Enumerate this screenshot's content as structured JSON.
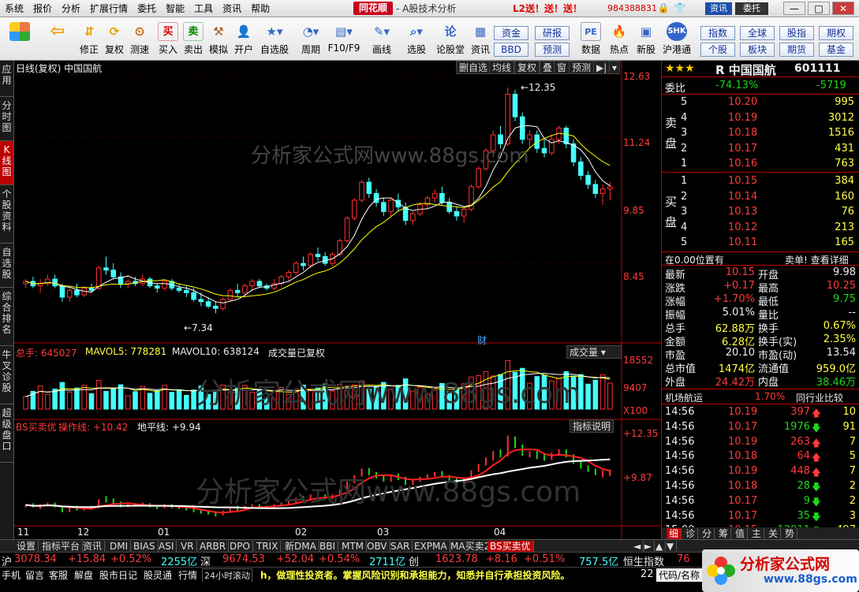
{
  "menu": [
    "系统",
    "报价",
    "分析",
    "扩展行情",
    "委托",
    "智能",
    "工具",
    "资讯",
    "帮助"
  ],
  "brand": "同花顺",
  "app_title": "- A股技术分析",
  "promo": "L2送！送！送！",
  "account": "984388831",
  "mini_buttons": {
    "news": "资讯",
    "trade": "委托"
  },
  "toolbar": [
    {
      "label": "",
      "icon": "windows-logo-icon"
    },
    {
      "label": "",
      "icon": "back-arrow-icon"
    },
    {
      "label": "修正",
      "icon": "up-down-arrow-icon"
    },
    {
      "label": "复权",
      "icon": "refresh-icon"
    },
    {
      "label": "测速",
      "icon": "clock-icon"
    },
    {
      "label": "买入",
      "icon": "buy-icon",
      "glyph": "买"
    },
    {
      "label": "卖出",
      "icon": "sell-icon",
      "glyph": "卖"
    },
    {
      "label": "模拟",
      "icon": "gavel-icon"
    },
    {
      "label": "开户",
      "icon": "person-icon"
    },
    {
      "label": "自选股",
      "icon": "star-list-icon"
    },
    {
      "label": "周期",
      "icon": "period-icon"
    },
    {
      "label": "F10/F9",
      "icon": "f10-icon"
    },
    {
      "label": "画线",
      "icon": "pencil-icon"
    },
    {
      "label": "选股",
      "icon": "stock-picker-icon"
    },
    {
      "label": "论股堂",
      "icon": "forum-icon"
    },
    {
      "label": "资讯",
      "icon": "news-icon"
    },
    {
      "label": "数据",
      "icon": "pe-icon",
      "glyph": "PE"
    },
    {
      "label": "热点",
      "icon": "hot-icon"
    },
    {
      "label": "新股",
      "icon": "new-stock-icon"
    },
    {
      "label": "沪港通",
      "icon": "shhk-icon"
    }
  ],
  "toolbar_right": [
    "资金",
    "研报",
    "BBD",
    "预测",
    "指数",
    "全球",
    "股指",
    "期权",
    "个股",
    "板块",
    "期货",
    "基金"
  ],
  "sidebar_tabs": [
    "应用",
    "分时图",
    "K线图",
    "个股资料",
    "自选股",
    "综合排名",
    "牛叉诊股",
    "超级盘口"
  ],
  "chart": {
    "header_left": "日线(复权) 中国国航",
    "header_buttons": [
      "删自选",
      "均线",
      "复权",
      "叠",
      "窗",
      "预测"
    ],
    "price_labels": [
      "12.63",
      "11.24",
      "9.85",
      "8.45"
    ],
    "max_label": "12.35",
    "min_label": "7.34",
    "watermark": "分析家公式网www.88gs.com",
    "fin_marker": "财",
    "vol_header": {
      "zongshou": "总手: 645027",
      "mavol5": "MAVOL5: 778281",
      "mavol10": "MAVOL10: 638124",
      "note": "成交量已复权",
      "selector": "成交量"
    },
    "vol_labels": [
      "18552",
      "9407",
      "X100"
    ],
    "bs_header": {
      "name": "BS买卖优",
      "op": "操作线: +10.42",
      "ground": "地平线: +9.94"
    },
    "bs_button": "指标说明",
    "bs_labels": [
      "+12.35",
      "+9.87"
    ],
    "x_labels": [
      "11",
      "12",
      "01",
      "02",
      "03",
      "04"
    ]
  },
  "chart_data": {
    "type": "candlestick",
    "title": "中国国航 日线(复权)",
    "ylim": [
      7.0,
      12.63
    ],
    "candles": [
      [
        8.0,
        8.1,
        7.9,
        8.05
      ],
      [
        8.05,
        8.15,
        7.9,
        7.95
      ],
      [
        7.95,
        8.1,
        7.8,
        8.0
      ],
      [
        8.0,
        8.2,
        7.95,
        8.1
      ],
      [
        8.1,
        8.2,
        7.9,
        7.95
      ],
      [
        7.95,
        8.0,
        7.6,
        7.7
      ],
      [
        7.7,
        7.9,
        7.6,
        7.85
      ],
      [
        7.85,
        8.0,
        7.7,
        7.75
      ],
      [
        7.75,
        7.95,
        7.7,
        7.9
      ],
      [
        7.9,
        8.0,
        7.8,
        7.85
      ],
      [
        7.9,
        8.4,
        7.85,
        8.35
      ],
      [
        8.35,
        8.6,
        8.2,
        8.3
      ],
      [
        8.3,
        8.45,
        8.1,
        8.15
      ],
      [
        8.15,
        8.25,
        7.9,
        8.0
      ],
      [
        8.0,
        8.1,
        7.9,
        8.05
      ],
      [
        8.05,
        8.15,
        7.95,
        8.0
      ],
      [
        8.0,
        8.2,
        7.95,
        8.1
      ],
      [
        8.1,
        8.15,
        7.9,
        7.95
      ],
      [
        7.95,
        8.0,
        7.8,
        7.9
      ],
      [
        7.9,
        8.1,
        7.85,
        8.05
      ],
      [
        8.05,
        8.1,
        7.85,
        7.9
      ],
      [
        7.9,
        8.0,
        7.8,
        7.85
      ],
      [
        7.85,
        7.95,
        7.7,
        7.8
      ],
      [
        7.8,
        7.9,
        7.6,
        7.65
      ],
      [
        7.65,
        7.8,
        7.5,
        7.6
      ],
      [
        7.6,
        7.7,
        7.45,
        7.5
      ],
      [
        7.5,
        7.6,
        7.34,
        7.45
      ],
      [
        7.45,
        7.7,
        7.4,
        7.65
      ],
      [
        7.65,
        7.9,
        7.6,
        7.85
      ],
      [
        7.85,
        8.0,
        7.7,
        7.8
      ],
      [
        7.8,
        8.0,
        7.75,
        7.95
      ],
      [
        7.95,
        8.1,
        7.85,
        8.05
      ],
      [
        8.05,
        8.1,
        7.9,
        7.95
      ],
      [
        7.95,
        8.0,
        7.85,
        7.9
      ],
      [
        7.9,
        8.1,
        7.85,
        8.0
      ],
      [
        8.0,
        8.2,
        7.95,
        8.15
      ],
      [
        8.15,
        8.3,
        8.05,
        8.25
      ],
      [
        8.25,
        8.5,
        8.2,
        8.45
      ],
      [
        8.45,
        8.6,
        8.3,
        8.4
      ],
      [
        8.4,
        8.7,
        8.35,
        8.65
      ],
      [
        8.65,
        8.8,
        8.5,
        8.6
      ],
      [
        8.6,
        8.7,
        8.4,
        8.45
      ],
      [
        8.45,
        8.7,
        8.4,
        8.65
      ],
      [
        8.65,
        9.0,
        8.6,
        8.95
      ],
      [
        8.95,
        9.5,
        8.9,
        9.45
      ],
      [
        9.45,
        9.9,
        9.4,
        9.85
      ],
      [
        9.85,
        10.3,
        9.8,
        10.25
      ],
      [
        10.25,
        10.35,
        9.9,
        10.0
      ],
      [
        10.0,
        10.1,
        9.7,
        9.8
      ],
      [
        9.8,
        9.9,
        9.5,
        9.6
      ],
      [
        9.6,
        9.9,
        9.5,
        9.85
      ],
      [
        9.85,
        10.0,
        9.6,
        9.7
      ],
      [
        9.7,
        9.8,
        9.3,
        9.4
      ],
      [
        9.4,
        9.6,
        9.3,
        9.55
      ],
      [
        9.55,
        9.8,
        9.5,
        9.75
      ],
      [
        9.75,
        9.95,
        9.65,
        9.9
      ],
      [
        9.9,
        10.1,
        9.8,
        10.0
      ],
      [
        10.0,
        10.15,
        9.75,
        9.8
      ],
      [
        9.8,
        9.9,
        9.55,
        9.6
      ],
      [
        9.6,
        9.7,
        9.4,
        9.5
      ],
      [
        9.5,
        9.7,
        9.35,
        9.65
      ],
      [
        9.65,
        10.2,
        9.6,
        10.15
      ],
      [
        10.15,
        10.6,
        10.1,
        10.55
      ],
      [
        10.55,
        11.0,
        10.5,
        10.95
      ],
      [
        10.95,
        11.4,
        10.8,
        11.3
      ],
      [
        11.3,
        11.5,
        11.0,
        11.1
      ],
      [
        11.1,
        12.35,
        11.05,
        12.2
      ],
      [
        12.2,
        12.3,
        11.6,
        11.7
      ],
      [
        11.7,
        11.8,
        11.1,
        11.2
      ],
      [
        11.2,
        11.4,
        11.0,
        11.3
      ],
      [
        11.3,
        11.4,
        10.9,
        11.0
      ],
      [
        11.0,
        11.2,
        10.8,
        10.9
      ],
      [
        10.9,
        11.3,
        10.85,
        11.2
      ],
      [
        11.2,
        11.5,
        11.1,
        11.45
      ],
      [
        11.45,
        11.5,
        11.0,
        11.1
      ],
      [
        11.1,
        11.2,
        10.6,
        10.7
      ],
      [
        10.7,
        10.8,
        10.3,
        10.4
      ],
      [
        10.4,
        10.5,
        10.1,
        10.2
      ],
      [
        10.2,
        10.3,
        9.9,
        10.0
      ],
      [
        10.0,
        10.2,
        9.75,
        10.1
      ],
      [
        10.1,
        10.25,
        9.85,
        10.15
      ]
    ],
    "volume_max": 18552
  },
  "quote": {
    "stars": "★★★",
    "name": "R 中国国航",
    "code": "601111",
    "weibi_label": "委比",
    "weibi": "-74.13%",
    "weicha": "-5719",
    "sell_side": "卖\n盘",
    "buy_side": "买\n盘",
    "asks": [
      {
        "lv": "5",
        "p": "10.20",
        "v": "995"
      },
      {
        "lv": "4",
        "p": "10.19",
        "v": "3012"
      },
      {
        "lv": "3",
        "p": "10.18",
        "v": "1516"
      },
      {
        "lv": "2",
        "p": "10.17",
        "v": "431"
      },
      {
        "lv": "1",
        "p": "10.16",
        "v": "763"
      }
    ],
    "bids": [
      {
        "lv": "1",
        "p": "10.15",
        "v": "384"
      },
      {
        "lv": "2",
        "p": "10.14",
        "v": "160"
      },
      {
        "lv": "3",
        "p": "10.13",
        "v": "76"
      },
      {
        "lv": "4",
        "p": "10.12",
        "v": "213"
      },
      {
        "lv": "5",
        "p": "10.11",
        "v": "165"
      }
    ],
    "pos_text": "在0.00位置有",
    "detail_text": "卖单! 查看详细",
    "stats_left": [
      {
        "k": "最新",
        "v": "10.15",
        "c": "red"
      },
      {
        "k": "涨跌",
        "v": "+0.17",
        "c": "red"
      },
      {
        "k": "涨幅",
        "v": "+1.70%",
        "c": "red"
      },
      {
        "k": "振幅",
        "v": "5.01%",
        "c": "white"
      },
      {
        "k": "总手",
        "v": "62.88万",
        "c": "yellow"
      },
      {
        "k": "金额",
        "v": "6.28亿",
        "c": "yellow"
      },
      {
        "k": "市盈",
        "v": "20.10",
        "c": "white"
      },
      {
        "k": "总市值",
        "v": "1474亿",
        "c": "yellow"
      },
      {
        "k": "外盘",
        "v": "24.42万",
        "c": "red"
      }
    ],
    "stats_right": [
      {
        "k": "开盘",
        "v": "9.98",
        "c": "white"
      },
      {
        "k": "最高",
        "v": "10.25",
        "c": "red"
      },
      {
        "k": "最低",
        "v": "9.75",
        "c": "green"
      },
      {
        "k": "量比",
        "v": "--",
        "c": "white"
      },
      {
        "k": "换手",
        "v": "0.67%",
        "c": "yellow"
      },
      {
        "k": "换手(实)",
        "v": "2.35%",
        "c": "yellow"
      },
      {
        "k": "市盈(动)",
        "v": "13.54",
        "c": "white"
      },
      {
        "k": "流通值",
        "v": "959.0亿",
        "c": "yellow"
      },
      {
        "k": "内盘",
        "v": "38.46万",
        "c": "green"
      }
    ],
    "sector": "机场航运",
    "sector_pct": "1.70%",
    "compare": "同行业比较",
    "ticks": [
      {
        "t": "14:56",
        "p": "10.19",
        "v": "397",
        "dir": "up",
        "n": "10"
      },
      {
        "t": "14:56",
        "p": "10.17",
        "v": "1976",
        "dir": "down",
        "n": "91"
      },
      {
        "t": "14:56",
        "p": "10.19",
        "v": "263",
        "dir": "up",
        "n": "7"
      },
      {
        "t": "14:56",
        "p": "10.18",
        "v": "64",
        "dir": "up",
        "n": "5"
      },
      {
        "t": "14:56",
        "p": "10.19",
        "v": "448",
        "dir": "up",
        "n": "7"
      },
      {
        "t": "14:56",
        "p": "10.18",
        "v": "28",
        "dir": "down",
        "n": "2"
      },
      {
        "t": "14:56",
        "p": "10.17",
        "v": "9",
        "dir": "down",
        "n": "2"
      },
      {
        "t": "14:56",
        "p": "10.17",
        "v": "35",
        "dir": "down",
        "n": "3"
      },
      {
        "t": "15:00",
        "p": "10.15",
        "v": "12011",
        "dir": "down",
        "n": "497"
      }
    ],
    "bottom_tabs": [
      "细",
      "诊",
      "分",
      "筹",
      "值",
      "主",
      "关",
      "势"
    ]
  },
  "bottom_tabs": [
    "设置",
    "指标平台",
    "资讯",
    "DMI",
    "BIAS",
    "ASI",
    "VR",
    "ARBR",
    "DPO",
    "TRIX",
    "新DMA",
    "BBI",
    "MTM",
    "OBV",
    "SAR",
    "EXPMA",
    "MA买卖2",
    "BS买卖优"
  ],
  "ticker1": {
    "sh_label": "沪",
    "sh": "3078.34",
    "sh_chg": "+15.84",
    "sh_pct": "+0.52%",
    "sh_amt": "2255亿",
    "sz_label": "深",
    "sz": "9674.53",
    "sz_chg": "+52.04",
    "sz_pct": "+0.54%",
    "sz_amt": "2711亿",
    "cy_label": "创",
    "cy": "1623.78",
    "cy_chg": "+8.16",
    "cy_pct": "+0.51%",
    "cy_amt": "757.5亿",
    "hs_label": "恒生指数",
    "hs": "76"
  },
  "ticker2": {
    "items": [
      "手机",
      "留言",
      "客服",
      "解盘",
      "股市日记",
      "股灵通",
      "行情"
    ],
    "scroll_btn": "24小时滚动",
    "notice": "h，做理性投资者。掌握风险识别和承担能力，知悉并自行承担投资风险。",
    "num": "22",
    "code_box": "代码/名称"
  },
  "logo": {
    "cn": "分析家公式网",
    "url": "www.88gs.com"
  }
}
